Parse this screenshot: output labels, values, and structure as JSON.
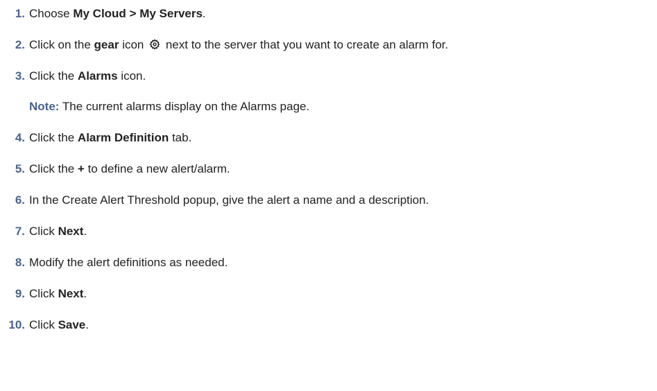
{
  "steps": [
    {
      "num": "1.",
      "pre": "Choose ",
      "bold": "My Cloud > My Servers",
      "post": "."
    },
    {
      "num": "2.",
      "pre": "Click on the ",
      "bold": "gear",
      "mid": " icon ",
      "icon": "gear-icon",
      "post": " next to the server that you want to create an alarm for."
    },
    {
      "num": "3.",
      "pre": "Click the ",
      "bold": "Alarms",
      "post": " icon."
    },
    {
      "num": "4.",
      "pre": "Click the ",
      "bold": "Alarm Definition",
      "post": " tab."
    },
    {
      "num": "5.",
      "pre": "Click the ",
      "bold": "+",
      "post": " to define a new alert/alarm."
    },
    {
      "num": "6.",
      "text": "In the Create Alert Threshold popup, give the alert a name and a description."
    },
    {
      "num": "7.",
      "pre": "Click ",
      "bold": "Next",
      "post": "."
    },
    {
      "num": "8.",
      "text": "Modify the alert definitions as needed."
    },
    {
      "num": "9.",
      "pre": "Click ",
      "bold": "Next",
      "post": "."
    },
    {
      "num": "10.",
      "pre": "Click ",
      "bold": "Save",
      "post": "."
    }
  ],
  "note": {
    "label": "Note:",
    "text": " The current alarms display on the Alarms page."
  },
  "colors": {
    "accent": "#4a6391",
    "text": "#222222"
  }
}
